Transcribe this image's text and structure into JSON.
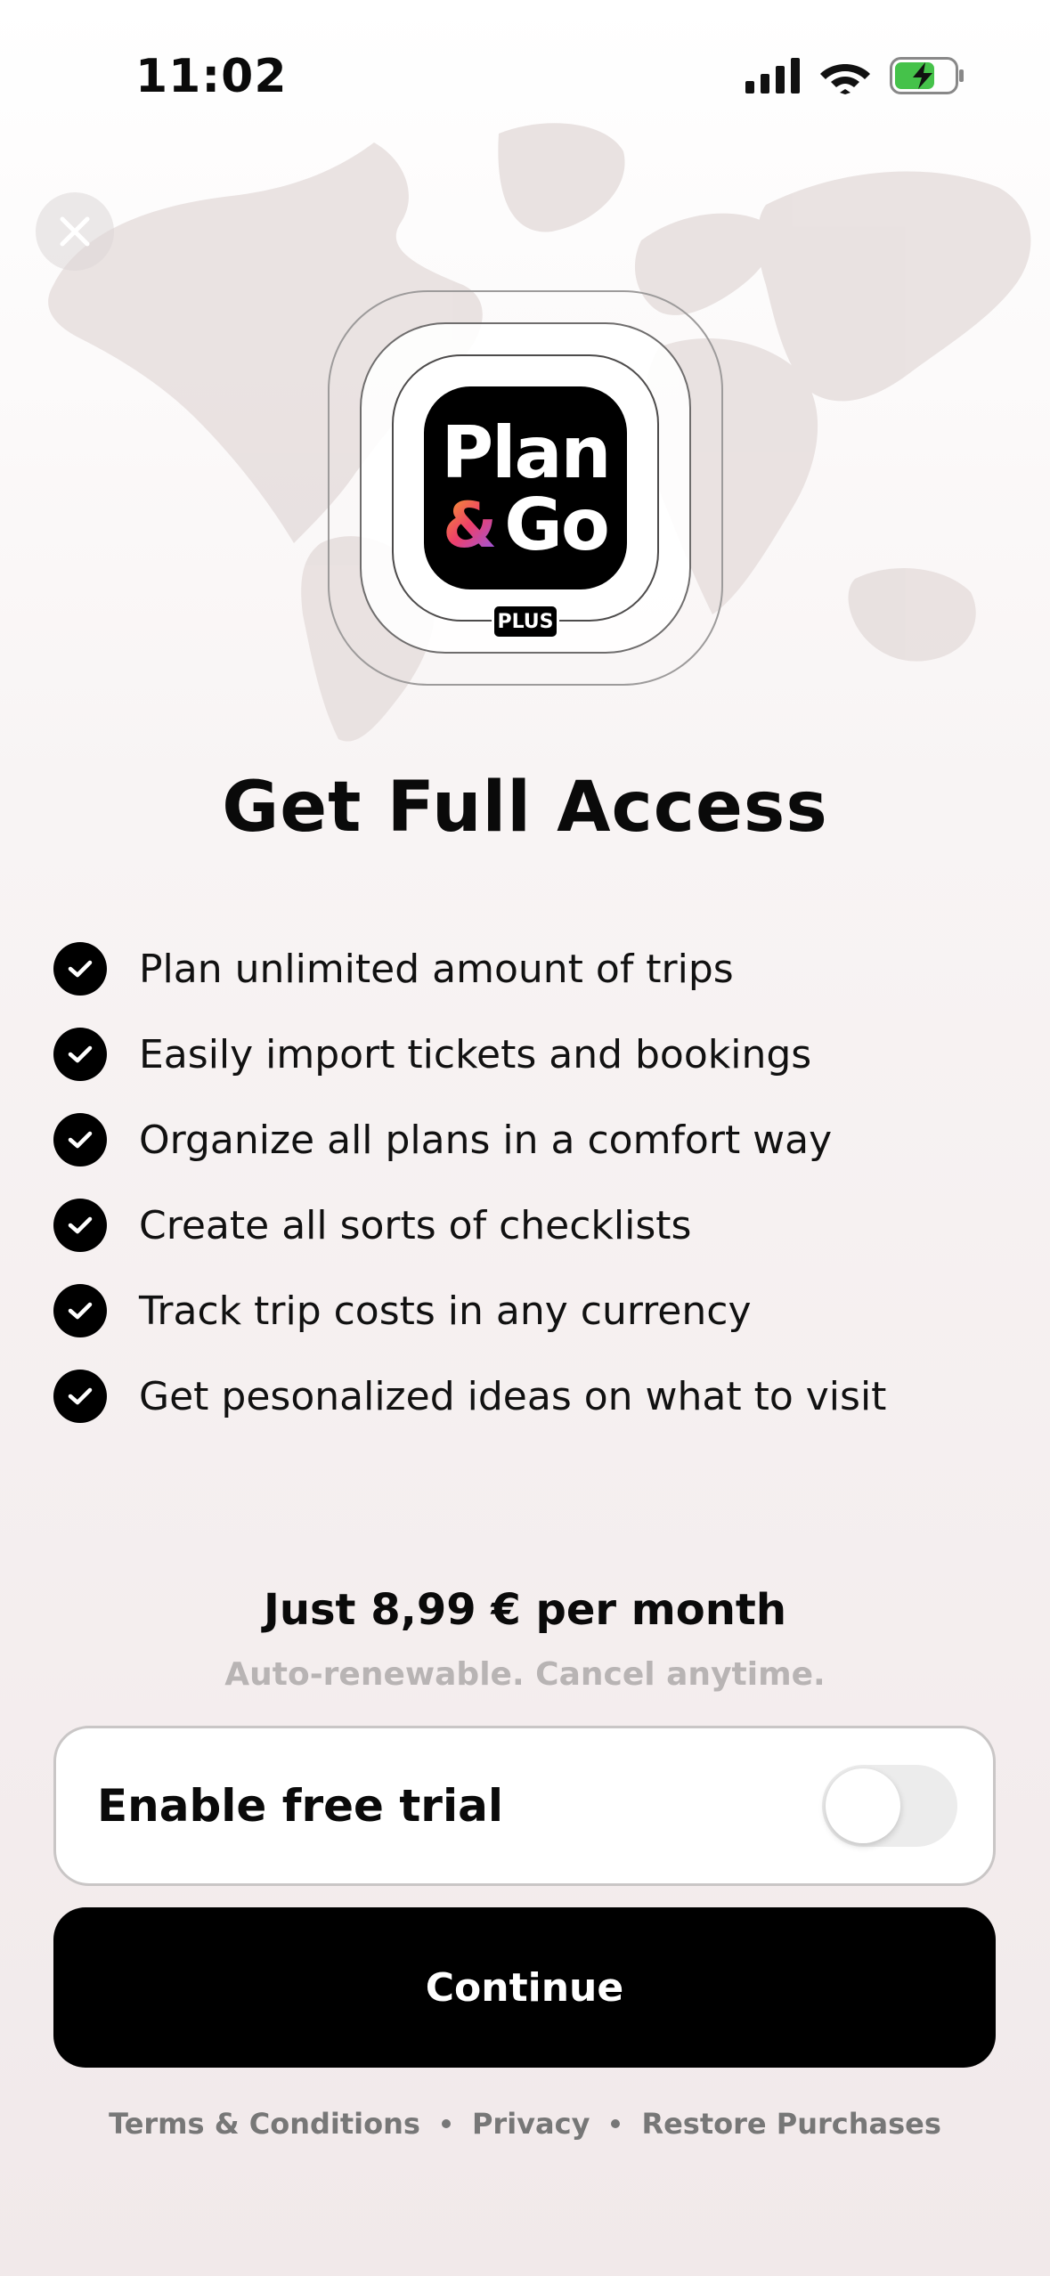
{
  "status_bar": {
    "time": "11:02"
  },
  "logo": {
    "line1": "Plan",
    "amp": "&",
    "line2": "Go",
    "badge": "PLUS"
  },
  "title": "Get Full Access",
  "features": [
    "Plan unlimited amount of trips",
    "Easily import tickets and bookings",
    "Organize all plans in a comfort way",
    "Create all sorts of checklists",
    "Track trip costs in any currency",
    "Get pesonalized ideas on what to visit"
  ],
  "pricing": {
    "price": "Just 8,99 € per month",
    "subtitle": "Auto-renewable. Cancel anytime."
  },
  "trial": {
    "label": "Enable free trial",
    "enabled": false
  },
  "continue_label": "Continue",
  "footer": {
    "terms": "Terms & Conditions",
    "privacy": "Privacy",
    "restore": "Restore Purchases"
  },
  "colors": {
    "primary": "#000000",
    "background": "#f4eeee",
    "muted": "#b8b4b4"
  }
}
